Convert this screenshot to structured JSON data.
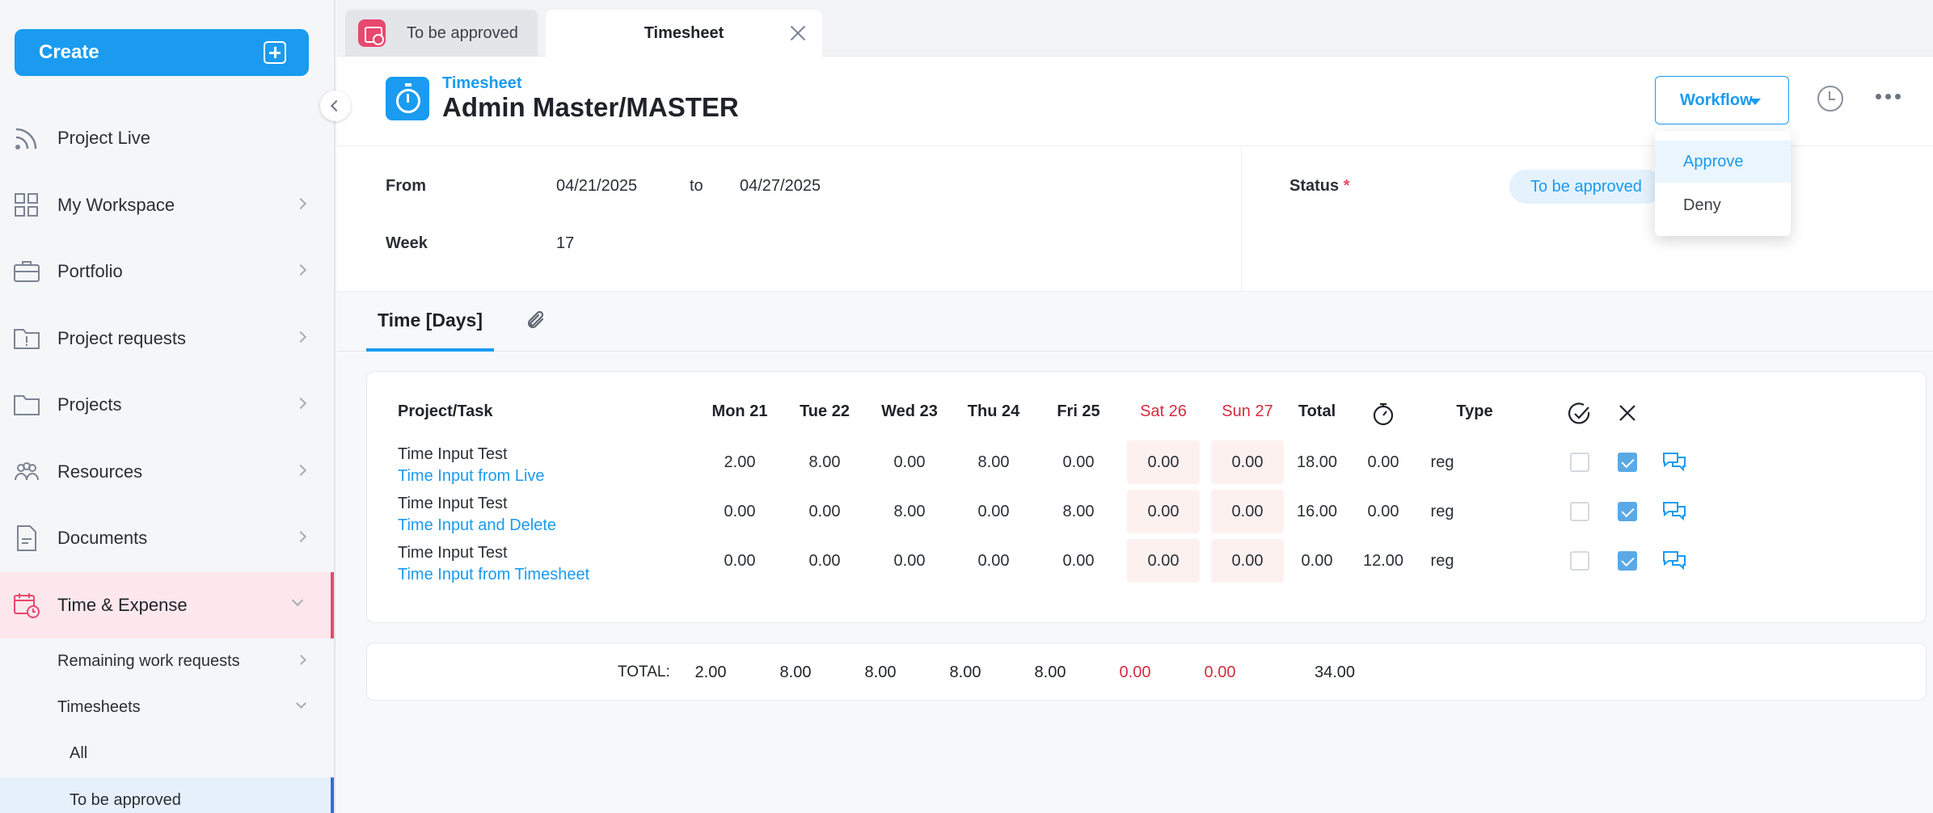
{
  "sidebar": {
    "create_label": "Create",
    "items": [
      {
        "label": "Project Live",
        "icon": "rss-icon"
      },
      {
        "label": "My Workspace",
        "icon": "grid-icon"
      },
      {
        "label": "Portfolio",
        "icon": "briefcase-icon"
      },
      {
        "label": "Project requests",
        "icon": "folder-alert-icon"
      },
      {
        "label": "Projects",
        "icon": "folder-icon"
      },
      {
        "label": "Resources",
        "icon": "people-icon"
      },
      {
        "label": "Documents",
        "icon": "document-icon"
      },
      {
        "label": "Time & Expense",
        "icon": "calendar-clock-icon"
      }
    ],
    "subitems": [
      {
        "label": "Remaining work requests"
      },
      {
        "label": "Timesheets"
      },
      {
        "label": "All"
      },
      {
        "label": "To be approved"
      }
    ]
  },
  "tabs": [
    {
      "label": "To be approved"
    },
    {
      "label": "Timesheet"
    }
  ],
  "header": {
    "subtitle": "Timesheet",
    "title": "Admin Master/MASTER",
    "workflow_label": "Workflow",
    "workflow_menu": [
      "Approve",
      "Deny"
    ]
  },
  "form": {
    "from_label": "From",
    "from_value": "04/21/2025",
    "to_label": "to",
    "to_value": "04/27/2025",
    "week_label": "Week",
    "week_value": "17",
    "status_label": "Status",
    "status_required": "*",
    "status_value": "To be approved"
  },
  "content_tab": "Time [Days]",
  "table": {
    "headers": {
      "project": "Project/Task",
      "days": [
        "Mon 21",
        "Tue 22",
        "Wed 23",
        "Thu 24",
        "Fri 25",
        "Sat 26",
        "Sun 27"
      ],
      "total": "Total",
      "type": "Type"
    },
    "rows": [
      {
        "project": "Time Input Test",
        "task": "Time Input from Live",
        "values": [
          "2.00",
          "8.00",
          "0.00",
          "8.00",
          "0.00",
          "0.00",
          "0.00"
        ],
        "total": "18.00",
        "timer": "0.00",
        "type": "reg",
        "approved": false,
        "rejected": true
      },
      {
        "project": "Time Input Test",
        "task": "Time Input and Delete",
        "values": [
          "0.00",
          "0.00",
          "8.00",
          "0.00",
          "8.00",
          "0.00",
          "0.00"
        ],
        "total": "16.00",
        "timer": "0.00",
        "type": "reg",
        "approved": false,
        "rejected": true
      },
      {
        "project": "Time Input Test",
        "task": "Time Input from Timesheet",
        "values": [
          "0.00",
          "0.00",
          "0.00",
          "0.00",
          "0.00",
          "0.00",
          "0.00"
        ],
        "total": "0.00",
        "timer": "12.00",
        "type": "reg",
        "approved": false,
        "rejected": true
      }
    ],
    "totals": {
      "label": "TOTAL:",
      "values": [
        "2.00",
        "8.00",
        "8.00",
        "8.00",
        "8.00",
        "0.00",
        "0.00"
      ],
      "total": "34.00"
    }
  },
  "colors": {
    "accent": "#1a9bf0",
    "active_section": "#e8486d",
    "weekend": "#d62b3f"
  }
}
